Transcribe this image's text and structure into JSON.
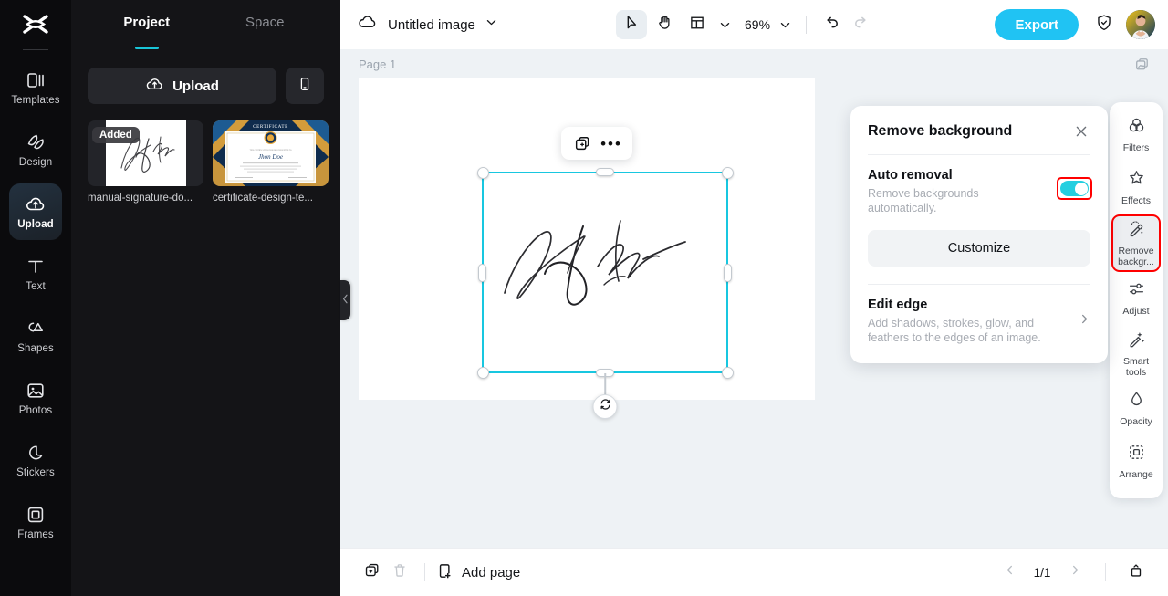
{
  "rail": {
    "logo_icon": "capcut-logo-icon",
    "items": [
      {
        "label": "Templates",
        "icon": "templates-icon",
        "active": false
      },
      {
        "label": "Design",
        "icon": "design-icon",
        "active": false
      },
      {
        "label": "Upload",
        "icon": "upload-cloud-icon",
        "active": true
      },
      {
        "label": "Text",
        "icon": "text-icon",
        "active": false
      },
      {
        "label": "Shapes",
        "icon": "shapes-icon",
        "active": false
      },
      {
        "label": "Photos",
        "icon": "photos-icon",
        "active": false
      },
      {
        "label": "Stickers",
        "icon": "stickers-icon",
        "active": false
      },
      {
        "label": "Frames",
        "icon": "frames-icon",
        "active": false
      }
    ]
  },
  "panel": {
    "tabs": [
      {
        "label": "Project",
        "active": true
      },
      {
        "label": "Space",
        "active": false
      }
    ],
    "upload_label": "Upload",
    "upload_icon": "upload-cloud-icon",
    "mobile_icon": "mobile-phone-icon",
    "thumbnails": [
      {
        "label": "manual-signature-do...",
        "badge": "Added",
        "kind": "signature"
      },
      {
        "label": "certificate-design-te...",
        "badge": "",
        "kind": "certificate"
      }
    ],
    "collapse_icon": "chevron-left-icon"
  },
  "topbar": {
    "cloud_icon": "cloud-icon",
    "doc_title": "Untitled image",
    "title_chevron_icon": "chevron-down-icon",
    "tools": [
      {
        "name": "select-tool",
        "icon": "cursor-arrow-icon",
        "selected": true
      },
      {
        "name": "hand-tool",
        "icon": "hand-icon",
        "selected": false
      },
      {
        "name": "layout-tool",
        "icon": "layout-grid-icon",
        "selected": false
      }
    ],
    "layout_chevron_icon": "chevron-down-icon",
    "zoom_level": "69%",
    "zoom_chevron_icon": "chevron-down-icon",
    "undo_icon": "undo-arrow-icon",
    "redo_icon": "redo-arrow-icon",
    "export_label": "Export",
    "shield_icon": "shield-check-icon",
    "avatar_icon": "user-avatar"
  },
  "canvas": {
    "page_label": "Page 1",
    "page_head_icon": "duplicate-page-icon",
    "selection_toolbar": {
      "duplicate_icon": "duplicate-layer-icon",
      "more_icon": "more-options-icon",
      "more_label": "•••"
    },
    "rotate_icon": "rotate-handle-icon",
    "selection_color": "#18c7e0"
  },
  "bottombar": {
    "duplicate_icon": "duplicate-page-icon",
    "delete_icon": "trash-icon",
    "add_page_icon": "add-page-icon",
    "add_page_label": "Add page",
    "prev_icon": "chevron-left-icon",
    "next_icon": "chevron-right-icon",
    "page_indicator": "1/1",
    "timeline_icon": "expand-panel-icon"
  },
  "right_rail": {
    "items": [
      {
        "label": "Filters",
        "icon": "filters-icon",
        "highlighted": false
      },
      {
        "label": "Effects",
        "icon": "effects-icon",
        "highlighted": false
      },
      {
        "label": "Remove backgr...",
        "icon": "remove-background-icon",
        "highlighted": true
      },
      {
        "label": "Adjust",
        "icon": "adjust-sliders-icon",
        "highlighted": false
      },
      {
        "label": "Smart tools",
        "icon": "smart-tools-icon",
        "highlighted": false
      },
      {
        "label": "Opacity",
        "icon": "opacity-drop-icon",
        "highlighted": false
      },
      {
        "label": "Arrange",
        "icon": "arrange-icon",
        "highlighted": false
      }
    ]
  },
  "remove_bg_panel": {
    "title": "Remove background",
    "close_icon": "close-icon",
    "auto_removal": {
      "title": "Auto removal",
      "subtitle": "Remove backgrounds automatically.",
      "toggle_on": true,
      "toggle_color": "#25cfe0"
    },
    "customize_label": "Customize",
    "edit_edge": {
      "title": "Edit edge",
      "subtitle": "Add shadows, strokes, glow, and feathers to the edges of an image.",
      "chevron_icon": "chevron-right-icon"
    }
  },
  "accents": {
    "brand_teal": "#19c5d8",
    "export_blue": "#20c3f3",
    "highlight_red": "#ff0000"
  }
}
